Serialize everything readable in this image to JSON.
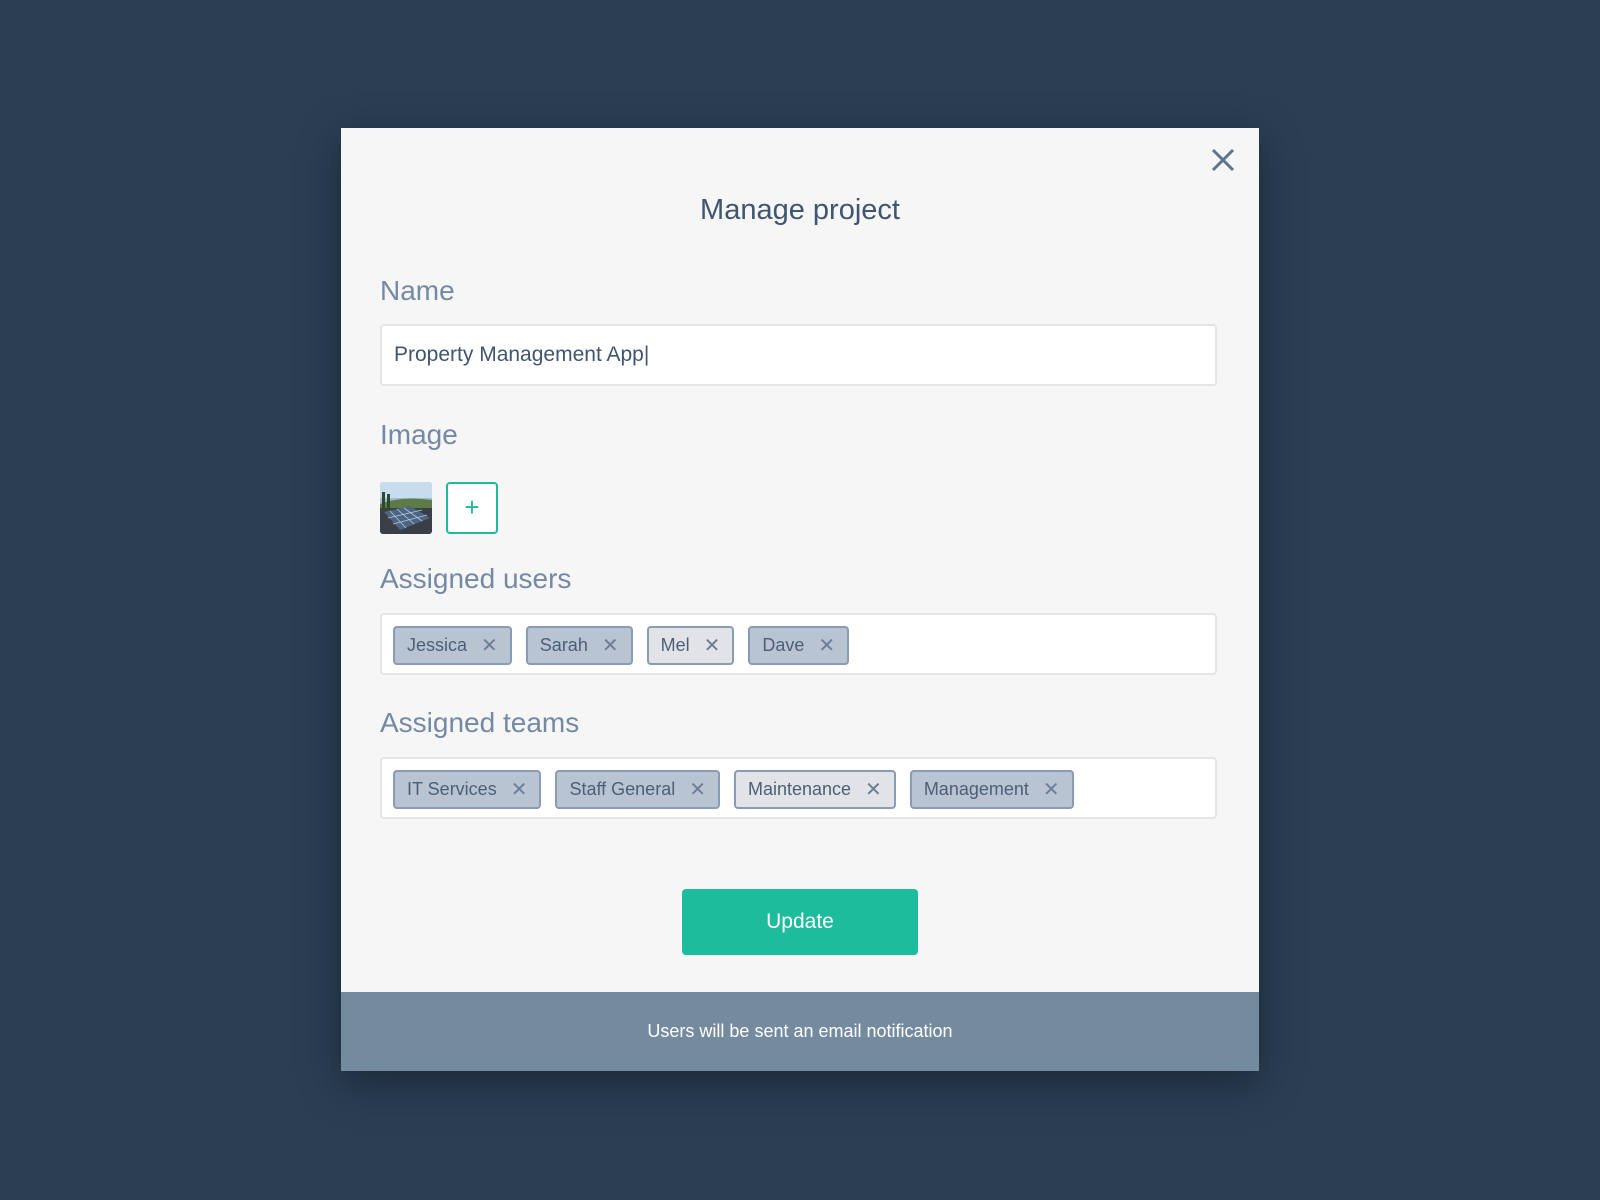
{
  "modal": {
    "title": "Manage project",
    "name_label": "Name",
    "name_value": "Property Management App|",
    "image_label": "Image",
    "add_image_symbol": "+",
    "image_icon": "solar-panel-thumbnail",
    "users_label": "Assigned users",
    "users": [
      "Jessica",
      "Sarah",
      "Mel",
      "Dave"
    ],
    "teams_label": "Assigned teams",
    "teams": [
      "IT Services",
      "Staff General",
      "Maintenance",
      "Management"
    ],
    "remove_symbol": "✕",
    "update_label": "Update",
    "footer_note": "Users will be sent an email notification"
  },
  "colors": {
    "background": "#2b3e54",
    "accent": "#1dbc9c",
    "footer": "#748a9f",
    "tag": "#b8c4d2",
    "tag_light": "#e1e3e6"
  }
}
